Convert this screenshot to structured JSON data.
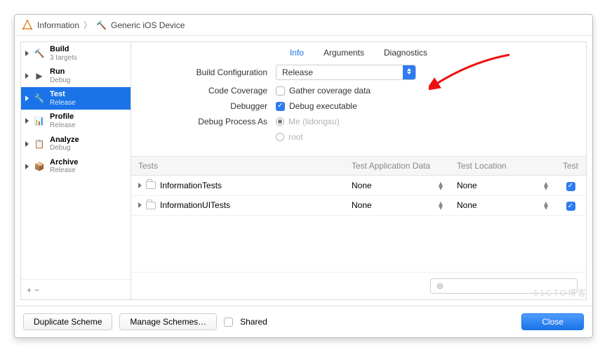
{
  "breadcrumb": {
    "project": "Information",
    "device": "Generic iOS Device"
  },
  "sidebar": {
    "items": [
      {
        "title": "Build",
        "sub": "3 targets"
      },
      {
        "title": "Run",
        "sub": "Debug"
      },
      {
        "title": "Test",
        "sub": "Release"
      },
      {
        "title": "Profile",
        "sub": "Release"
      },
      {
        "title": "Analyze",
        "sub": "Debug"
      },
      {
        "title": "Archive",
        "sub": "Release"
      }
    ],
    "add": "+",
    "remove": "−"
  },
  "tabs": {
    "info": "Info",
    "arguments": "Arguments",
    "diagnostics": "Diagnostics"
  },
  "form": {
    "buildConfig_label": "Build Configuration",
    "buildConfig_value": "Release",
    "codeCoverage_label": "Code Coverage",
    "codeCoverage_text": "Gather coverage data",
    "debugger_label": "Debugger",
    "debugger_text": "Debug executable",
    "debugProcess_label": "Debug Process As",
    "debugProcess_me": "Me (lidongxu)",
    "debugProcess_root": "root"
  },
  "tests": {
    "headers": {
      "tests": "Tests",
      "app": "Test Application Data",
      "loc": "Test Location",
      "test": "Test"
    },
    "rows": [
      {
        "name": "InformationTests",
        "app": "None",
        "loc": "None",
        "checked": true
      },
      {
        "name": "InformationUITests",
        "app": "None",
        "loc": "None",
        "checked": true
      }
    ],
    "filter_placeholder": "⊜"
  },
  "footer": {
    "duplicate": "Duplicate Scheme",
    "manage": "Manage Schemes…",
    "shared": "Shared",
    "close": "Close"
  },
  "watermark": "51CTO博客"
}
